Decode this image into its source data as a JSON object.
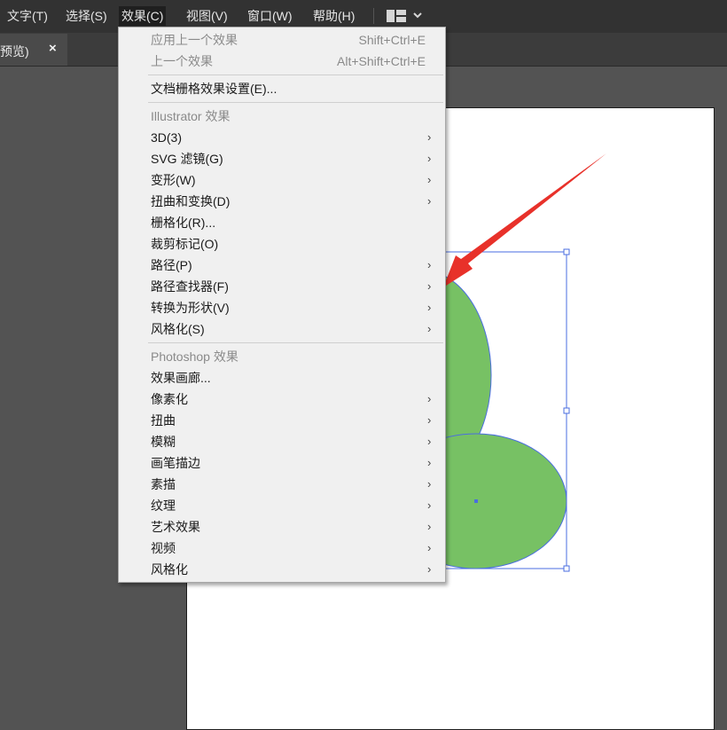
{
  "menubar": {
    "items": [
      "文字(T)",
      "选择(S)",
      "效果(C)",
      "视图(V)",
      "窗口(W)",
      "帮助(H)"
    ],
    "workspace_icon": "layout-grid-icon",
    "workspace_chevron": "chevron-down-icon"
  },
  "tab": {
    "label": "预览)",
    "close": "×"
  },
  "effect_menu": {
    "apply_last": {
      "label": "应用上一个效果",
      "shortcut": "Shift+Ctrl+E"
    },
    "last_effect": {
      "label": "上一个效果",
      "shortcut": "Alt+Shift+Ctrl+E"
    },
    "raster_settings": "文档栅格效果设置(E)...",
    "illustrator_header": "Illustrator 效果",
    "illustrator_items": [
      {
        "label": "3D(3)",
        "submenu": true
      },
      {
        "label": "SVG 滤镜(G)",
        "submenu": true
      },
      {
        "label": "变形(W)",
        "submenu": true
      },
      {
        "label": "扭曲和变换(D)",
        "submenu": true
      },
      {
        "label": "栅格化(R)...",
        "submenu": false
      },
      {
        "label": "裁剪标记(O)",
        "submenu": false
      },
      {
        "label": "路径(P)",
        "submenu": true
      },
      {
        "label": "路径查找器(F)",
        "submenu": true
      },
      {
        "label": "转换为形状(V)",
        "submenu": true
      },
      {
        "label": "风格化(S)",
        "submenu": true
      }
    ],
    "photoshop_header": "Photoshop 效果",
    "photoshop_items": [
      {
        "label": "效果画廊...",
        "submenu": false
      },
      {
        "label": "像素化",
        "submenu": true
      },
      {
        "label": "扭曲",
        "submenu": true
      },
      {
        "label": "模糊",
        "submenu": true
      },
      {
        "label": "画笔描边",
        "submenu": true
      },
      {
        "label": "素描",
        "submenu": true
      },
      {
        "label": "纹理",
        "submenu": true
      },
      {
        "label": "艺术效果",
        "submenu": true
      },
      {
        "label": "视频",
        "submenu": true
      },
      {
        "label": "风格化",
        "submenu": true
      }
    ],
    "submenu_arrow": "›"
  },
  "colors": {
    "shape_fill": "#77c164",
    "selection": "#4a6ee0",
    "annotation_arrow": "#e8312a"
  }
}
